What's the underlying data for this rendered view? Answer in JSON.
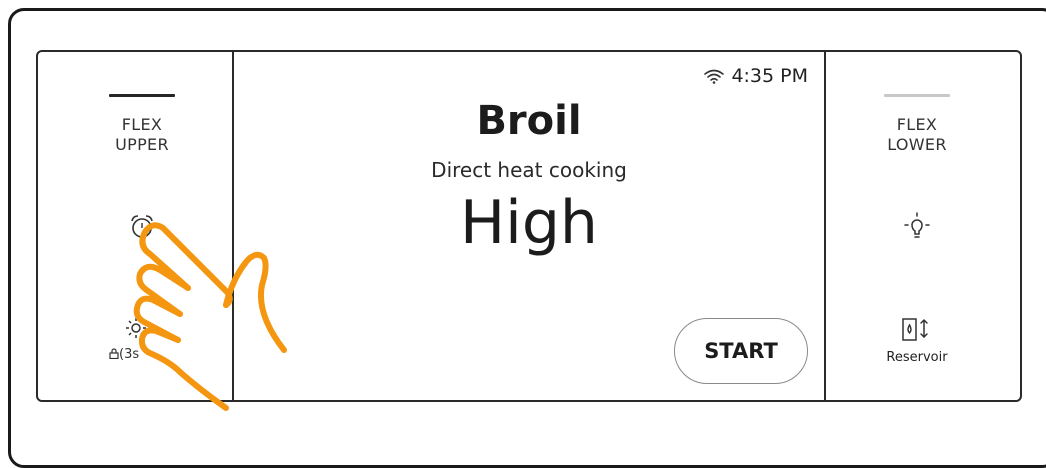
{
  "accent_color": "#f4960f",
  "left": {
    "zone_label": "FLEX\nUPPER",
    "timer_icon": "alarm-clock-icon",
    "settings_icon": "gear-icon",
    "lock_icon": "lock-icon",
    "lock_hold_label": "(3s"
  },
  "status": {
    "wifi_icon": "wifi-icon",
    "time": "4:35 PM"
  },
  "main": {
    "mode": "Broil",
    "description": "Direct heat cooking",
    "level": "High",
    "start_label": "START"
  },
  "right": {
    "zone_label": "FLEX\nLOWER",
    "light_icon": "light-bulb-icon",
    "reservoir_icon": "water-reservoir-icon",
    "reservoir_label": "Reservoir"
  },
  "overlay": {
    "hand_icon": "pointing-hand-icon"
  }
}
